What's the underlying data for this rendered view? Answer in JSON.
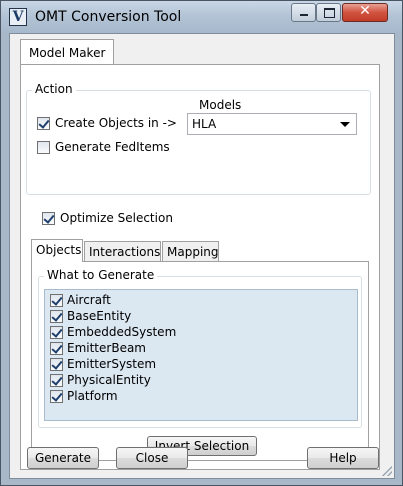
{
  "window": {
    "title": "OMT Conversion Tool",
    "icon": "app-icon-v",
    "icon_glyph": "V",
    "close_glyph": "✕"
  },
  "outer_tab": {
    "label": "Model Maker"
  },
  "action": {
    "legend": "Action",
    "create_objects": {
      "label": "Create Objects in ->",
      "checked": true
    },
    "generate_feditems": {
      "label": "Generate FedItems",
      "checked": false
    },
    "models_label": "Models",
    "models_value": "HLA"
  },
  "optimize_selection": {
    "label": "Optimize Selection",
    "checked": true
  },
  "inner_tabs": [
    {
      "label": "Objects",
      "active": true
    },
    {
      "label": "Interactions",
      "active": false
    },
    {
      "label": "Mapping",
      "active": false
    }
  ],
  "what_to_generate": {
    "legend": "What to Generate",
    "items": [
      {
        "label": "Aircraft",
        "checked": true
      },
      {
        "label": "BaseEntity",
        "checked": true
      },
      {
        "label": "EmbeddedSystem",
        "checked": true
      },
      {
        "label": "EmitterBeam",
        "checked": true
      },
      {
        "label": "EmitterSystem",
        "checked": true
      },
      {
        "label": "PhysicalEntity",
        "checked": true
      },
      {
        "label": "Platform",
        "checked": true
      }
    ]
  },
  "buttons": {
    "invert_selection": "Invert Selection",
    "generate": "Generate",
    "close": "Close",
    "help": "Help"
  },
  "colors": {
    "frame": "#a9b8c8",
    "list_background": "#dbe7f1",
    "close_button": "#c23c28"
  }
}
